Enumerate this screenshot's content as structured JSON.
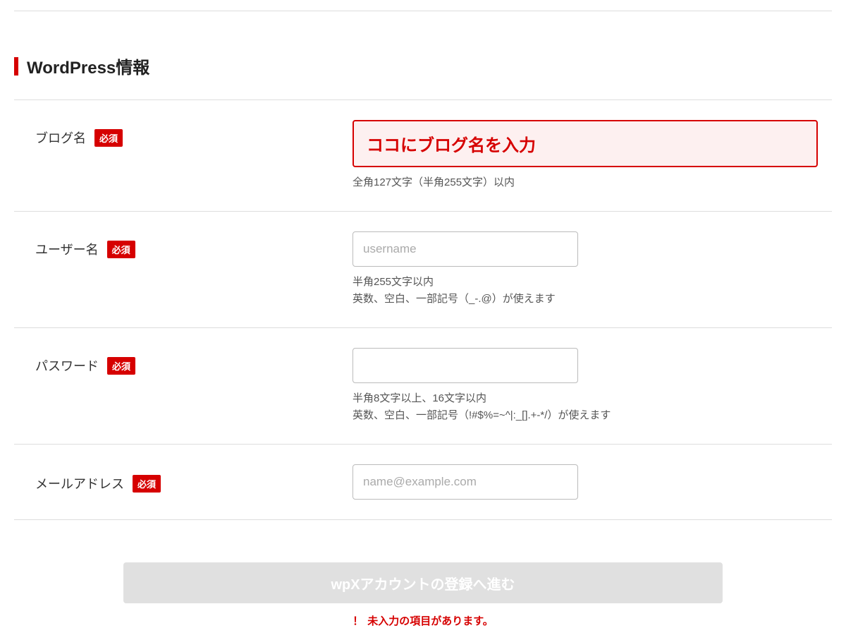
{
  "section": {
    "title": "WordPress情報"
  },
  "form": {
    "blog_name": {
      "label": "ブログ名",
      "required_badge": "必須",
      "highlight_text": "ココにブログ名を入力",
      "help": "全角127文字（半角255文字）以内"
    },
    "username": {
      "label": "ユーザー名",
      "required_badge": "必須",
      "placeholder": "username",
      "help_line1": "半角255文字以内",
      "help_line2": "英数、空白、一部記号（_-.@）が使えます"
    },
    "password": {
      "label": "パスワード",
      "required_badge": "必須",
      "help_line1": "半角8文字以上、16文字以内",
      "help_line2": "英数、空白、一部記号（!#$%=~^|:_[].+-*/）が使えます"
    },
    "email": {
      "label": "メールアドレス",
      "required_badge": "必須",
      "placeholder": "name@example.com"
    }
  },
  "submit": {
    "button_label": "wpXアカウントの登録へ進む",
    "error_icon": "！",
    "error_message": "未入力の項目があります。"
  }
}
